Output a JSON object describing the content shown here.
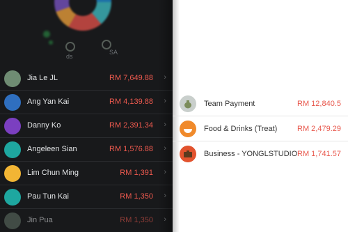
{
  "chart_header": {
    "labels": [
      "ds",
      "SA"
    ]
  },
  "people": [
    {
      "name": "Jia Le JL",
      "amount": "RM 7,649.88",
      "avatar_icon": "camera-avatar-icon",
      "color": "#6f8c73"
    },
    {
      "name": "Ang Yan Kai",
      "amount": "RM 4,139.88",
      "avatar_icon": "landscape-avatar-icon",
      "color": "#2f6fbf"
    },
    {
      "name": "Danny Ko",
      "amount": "RM 2,391.34",
      "avatar_icon": "person-avatar-icon",
      "color": "#7b3fc0"
    },
    {
      "name": "Angeleen Sian",
      "amount": "RM 1,576.88",
      "avatar_icon": "monitor-avatar-icon",
      "color": "#1ea7a0"
    },
    {
      "name": "Lim Chun Ming",
      "amount": "RM 1,391",
      "avatar_icon": "camera-avatar-icon",
      "color": "#f2b534"
    },
    {
      "name": "Pau Tun Kai",
      "amount": "RM 1,350",
      "avatar_icon": "monitor-avatar-icon",
      "color": "#1ea7a0"
    },
    {
      "name": "Jin Pua",
      "amount": "RM 1,350",
      "avatar_icon": "monitor-avatar-icon",
      "color": "#6a7d6f"
    }
  ],
  "categories": [
    {
      "name": "Team Payment",
      "amount": "RM 12,840.5",
      "icon": "money-bag-icon",
      "color": "#c9cfcc"
    },
    {
      "name": "Food & Drinks (Treat)",
      "amount": "RM 2,479.29",
      "icon": "bowl-icon",
      "color": "#f08a2b"
    },
    {
      "name": "Business - YONGLSTUDIO",
      "amount": "RM 1,741.57",
      "icon": "briefcase-icon",
      "color": "#e2532e"
    }
  ],
  "chevron": "›"
}
